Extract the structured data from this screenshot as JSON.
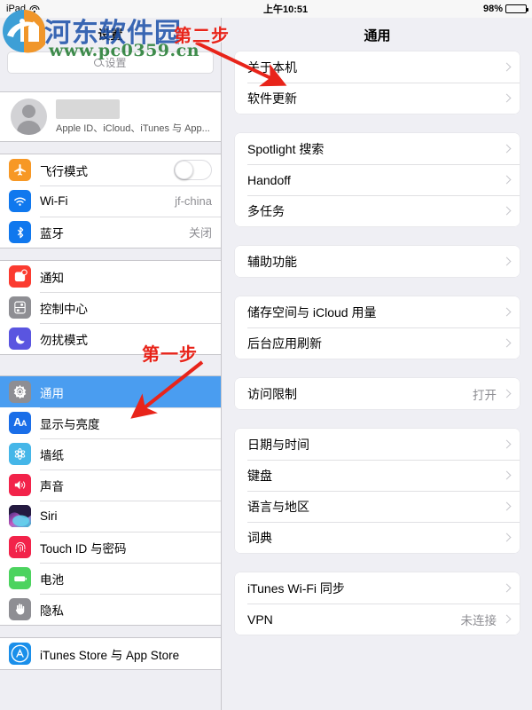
{
  "status_bar": {
    "device_label": "iPad",
    "wifi_icon": "wifi-icon",
    "time": "上午10:51",
    "battery_percent": "98%",
    "battery_level": 98
  },
  "watermark": {
    "site_name": "河东软件园",
    "url": "www.pc0359.cn",
    "logo_icon": "site-logo-icon"
  },
  "annotations": [
    {
      "id": "step1",
      "label": "第一步"
    },
    {
      "id": "step2",
      "label": "第二步"
    }
  ],
  "sidebar": {
    "title": "设置",
    "search": {
      "placeholder": "设置",
      "value": "",
      "icon": "search-icon"
    },
    "profile": {
      "name_redacted": "",
      "subtitle": "Apple ID、iCloud、iTunes 与 App...",
      "avatar_icon": "person-avatar-icon"
    },
    "groups": [
      {
        "items": [
          {
            "label": "飞行模式",
            "icon": "airplane-icon",
            "icon_color": "#f79825",
            "type": "toggle",
            "toggle_on": false
          },
          {
            "label": "Wi-Fi",
            "icon": "wifi-icon",
            "icon_color": "#1078ee",
            "type": "value",
            "value": "jf-china"
          },
          {
            "label": "蓝牙",
            "icon": "bluetooth-icon",
            "icon_color": "#1078ee",
            "type": "value",
            "value": "关闭"
          }
        ]
      },
      {
        "items": [
          {
            "label": "通知",
            "icon": "notifications-icon",
            "icon_color": "#fb3b30",
            "type": "plain"
          },
          {
            "label": "控制中心",
            "icon": "control-center-icon",
            "icon_color": "#8e8e93",
            "type": "plain"
          },
          {
            "label": "勿扰模式",
            "icon": "moon-icon",
            "icon_color": "#5a55e0",
            "type": "plain"
          }
        ]
      },
      {
        "items": [
          {
            "label": "通用",
            "icon": "gear-icon",
            "icon_color": "#8e8e93",
            "type": "plain",
            "selected": true
          },
          {
            "label": "显示与亮度",
            "icon": "display-brightness-icon",
            "icon_color": "#1a6ee8",
            "type": "plain"
          },
          {
            "label": "墙纸",
            "icon": "wallpaper-icon",
            "icon_color": "#45b6e8",
            "type": "plain"
          },
          {
            "label": "声音",
            "icon": "sound-icon",
            "icon_color": "#f2234a",
            "type": "plain"
          },
          {
            "label": "Siri",
            "icon": "siri-icon",
            "icon_color": "#2b2b4a",
            "type": "plain"
          },
          {
            "label": "Touch ID 与密码",
            "icon": "touch-id-icon",
            "icon_color": "#f2234a",
            "type": "plain"
          },
          {
            "label": "电池",
            "icon": "battery-icon",
            "icon_color": "#4cd35f",
            "type": "plain"
          },
          {
            "label": "隐私",
            "icon": "privacy-hand-icon",
            "icon_color": "#8e8e93",
            "type": "plain"
          }
        ]
      },
      {
        "items": [
          {
            "label": "iTunes Store 与 App Store",
            "icon": "app-store-icon",
            "icon_color": "#1a8fea",
            "type": "plain"
          }
        ]
      }
    ]
  },
  "detail": {
    "title": "通用",
    "groups": [
      {
        "items": [
          {
            "label": "关于本机",
            "chevron": true
          },
          {
            "label": "软件更新",
            "chevron": true
          }
        ]
      },
      {
        "items": [
          {
            "label": "Spotlight 搜索",
            "chevron": true
          },
          {
            "label": "Handoff",
            "chevron": true
          },
          {
            "label": "多任务",
            "chevron": true
          }
        ]
      },
      {
        "items": [
          {
            "label": "辅助功能",
            "chevron": true
          }
        ]
      },
      {
        "items": [
          {
            "label": "储存空间与 iCloud 用量",
            "chevron": true
          },
          {
            "label": "后台应用刷新",
            "chevron": true
          }
        ]
      },
      {
        "items": [
          {
            "label": "访问限制",
            "value": "打开",
            "chevron": true
          }
        ]
      },
      {
        "items": [
          {
            "label": "日期与时间",
            "chevron": true
          },
          {
            "label": "键盘",
            "chevron": true
          },
          {
            "label": "语言与地区",
            "chevron": true
          },
          {
            "label": "词典",
            "chevron": true
          }
        ]
      },
      {
        "items": [
          {
            "label": "iTunes Wi-Fi 同步",
            "chevron": true
          },
          {
            "label": "VPN",
            "value": "未连接",
            "chevron": true
          }
        ]
      }
    ]
  },
  "colors": {
    "selection_blue": "#4a9df0",
    "annotation_red": "#e8241a",
    "panel_bg": "#efeff4",
    "sidebar_bg": "#eeeef3"
  }
}
